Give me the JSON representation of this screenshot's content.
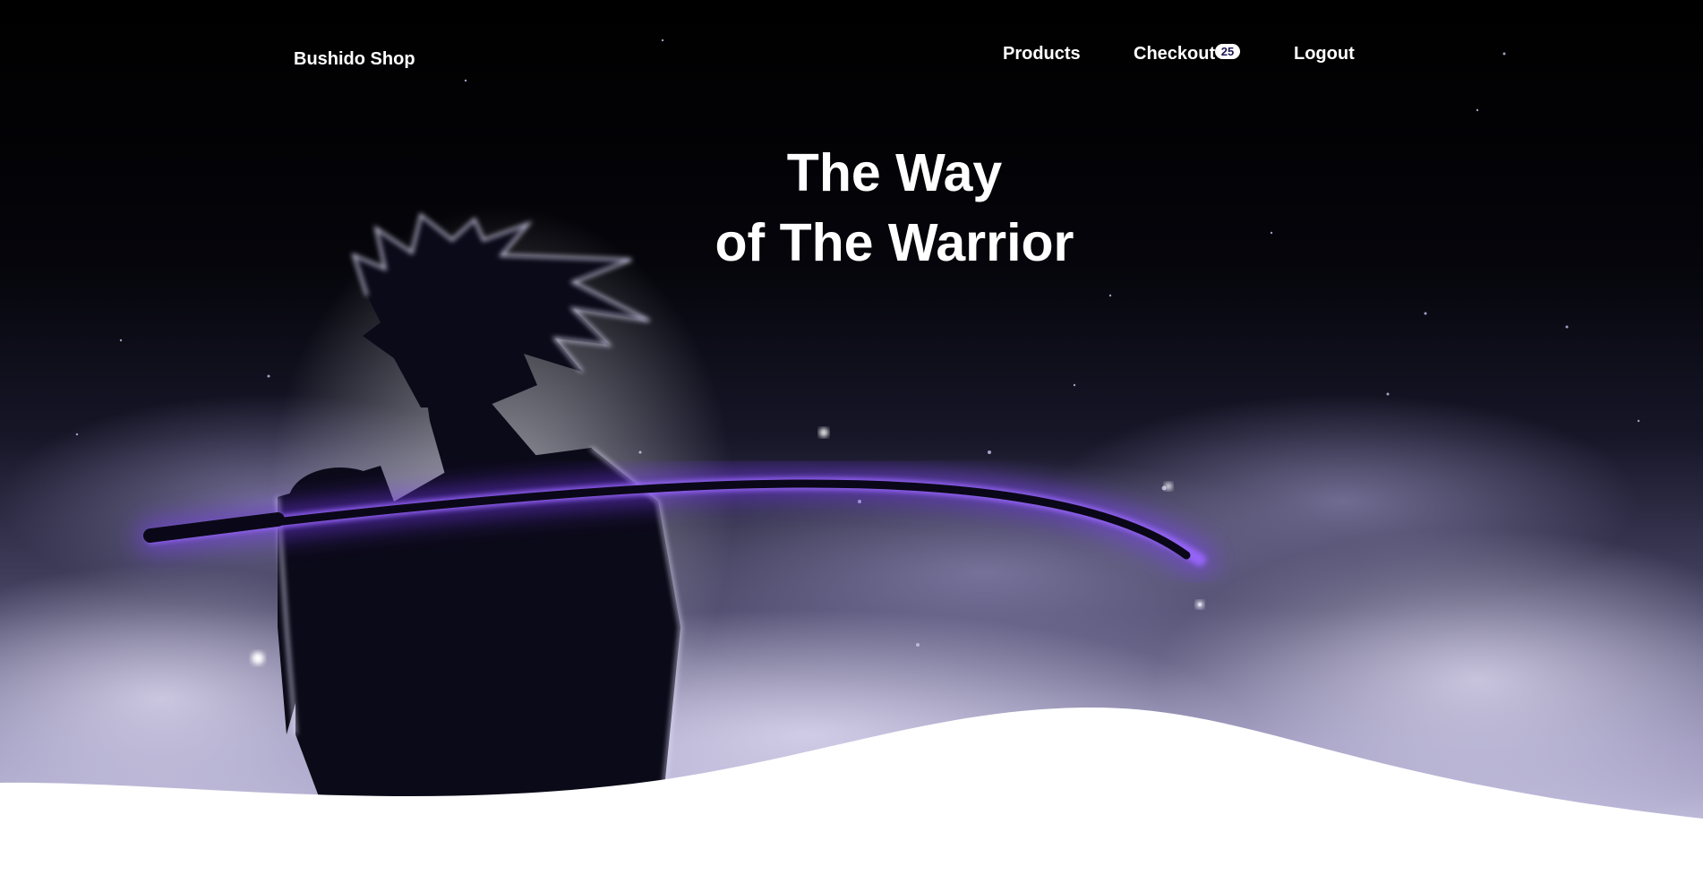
{
  "navbar": {
    "brand": "Bushido Shop",
    "links": {
      "products": "Products",
      "checkout": "Checkout",
      "logout": "Logout"
    },
    "cart_count": "25"
  },
  "hero": {
    "title_line_1": "The Way",
    "title_line_2": "of The Warrior",
    "image_subject": "silhouette of a samurai warrior holding a glowing katana over the shoulder, purple mist and night sky"
  },
  "colors": {
    "sky": "#000000",
    "mist": "#c9c4e6",
    "katana_glow": "#7b3cff",
    "text": "#ffffff",
    "page_background": "#ffffff"
  }
}
